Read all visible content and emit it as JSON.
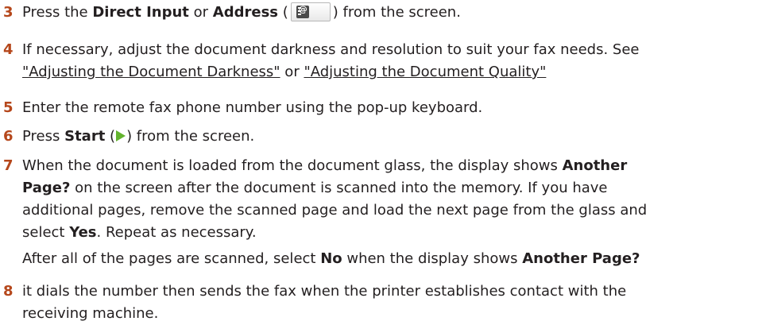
{
  "steps": [
    {
      "number": "3",
      "parts": {
        "a": "Press the ",
        "b": "Direct Input",
        "c": " or ",
        "d": "Address",
        "e": " (",
        "f": ") from the screen."
      },
      "icon": "address-book-icon"
    },
    {
      "number": "4",
      "parts": {
        "a": "If necessary, adjust the document darkness and resolution to suit your fax needs. See ",
        "link1": "\"Adjusting the Document Darkness\"",
        "b": " or ",
        "link2": "\"Adjusting the Document Quality\""
      }
    },
    {
      "number": "5",
      "text": "Enter the remote fax phone number using the pop-up keyboard."
    },
    {
      "number": "6",
      "parts": {
        "a": "Press ",
        "b": "Start",
        "c": " (",
        "d": ") from the screen."
      },
      "icon": "start-play-icon",
      "icon_color": "#63b32e"
    },
    {
      "number": "7",
      "lines": {
        "l1a": "When the document is loaded from the document glass, the display shows ",
        "l1b": "Another",
        "l2a": "Page?",
        "l2b": " on the screen after the document is scanned into the memory. If you have",
        "l3": "additional pages, remove the scanned page and load the next page from the glass and",
        "l4a": "select ",
        "l4b": "Yes",
        "l4c": ". Repeat as necessary."
      },
      "note": {
        "a": "After all of the pages are scanned, select ",
        "b": "No",
        "c": " when the display shows ",
        "d": "Another Page?"
      }
    },
    {
      "number": "8",
      "lines": {
        "l1": "it dials the number then sends the fax when the printer establishes contact with the",
        "l2": "receiving machine."
      }
    }
  ],
  "colors": {
    "step_number": "#b5471b",
    "text": "#231f20"
  }
}
